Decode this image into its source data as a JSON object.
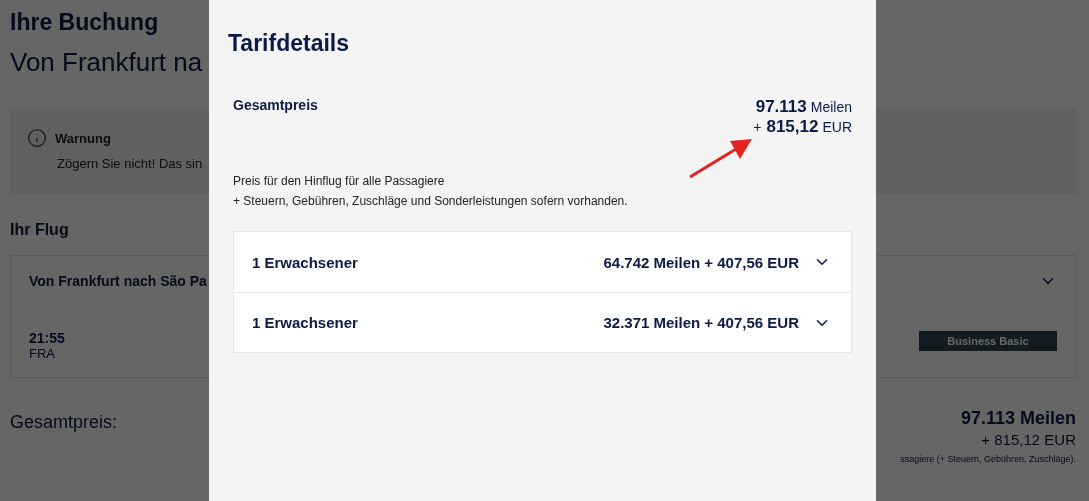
{
  "page": {
    "title": "Ihre Buchung",
    "subtitle": "Von Frankfurt na",
    "warning": {
      "title": "Warnung",
      "text": "Zögern Sie nicht! Das sin"
    },
    "flight_section": {
      "title": "Ihr Flug",
      "card_title": "Von Frankfurt nach São Pa",
      "expanded": false,
      "departure_time": "21:55",
      "departure_airport": "FRA",
      "fare_badge": "Business Basic"
    },
    "total": {
      "label": "Gesamtpreis:",
      "miles": "97.113 Meilen",
      "cash": "+ 815,12 EUR",
      "note": "ssagiere (+ Steuern, Gebühren, Zuschläge)."
    }
  },
  "modal": {
    "title": "Tarifdetails",
    "total": {
      "label": "Gesamtpreis",
      "miles": "97.113",
      "miles_unit": "Meilen",
      "plus": "+",
      "cash": "815,12",
      "cash_unit": "EUR"
    },
    "note_lines": [
      "Preis für den Hinflug für alle Passagiere",
      "+ Steuern, Gebühren, Zuschläge und Sonderleistungen sofern vorhanden."
    ],
    "passengers": [
      {
        "label": "1 Erwachsener",
        "price": "64.742 Meilen + 407,56 EUR",
        "expanded": false
      },
      {
        "label": "1 Erwachsener",
        "price": "32.371 Meilen + 407,56 EUR",
        "expanded": false
      }
    ]
  }
}
